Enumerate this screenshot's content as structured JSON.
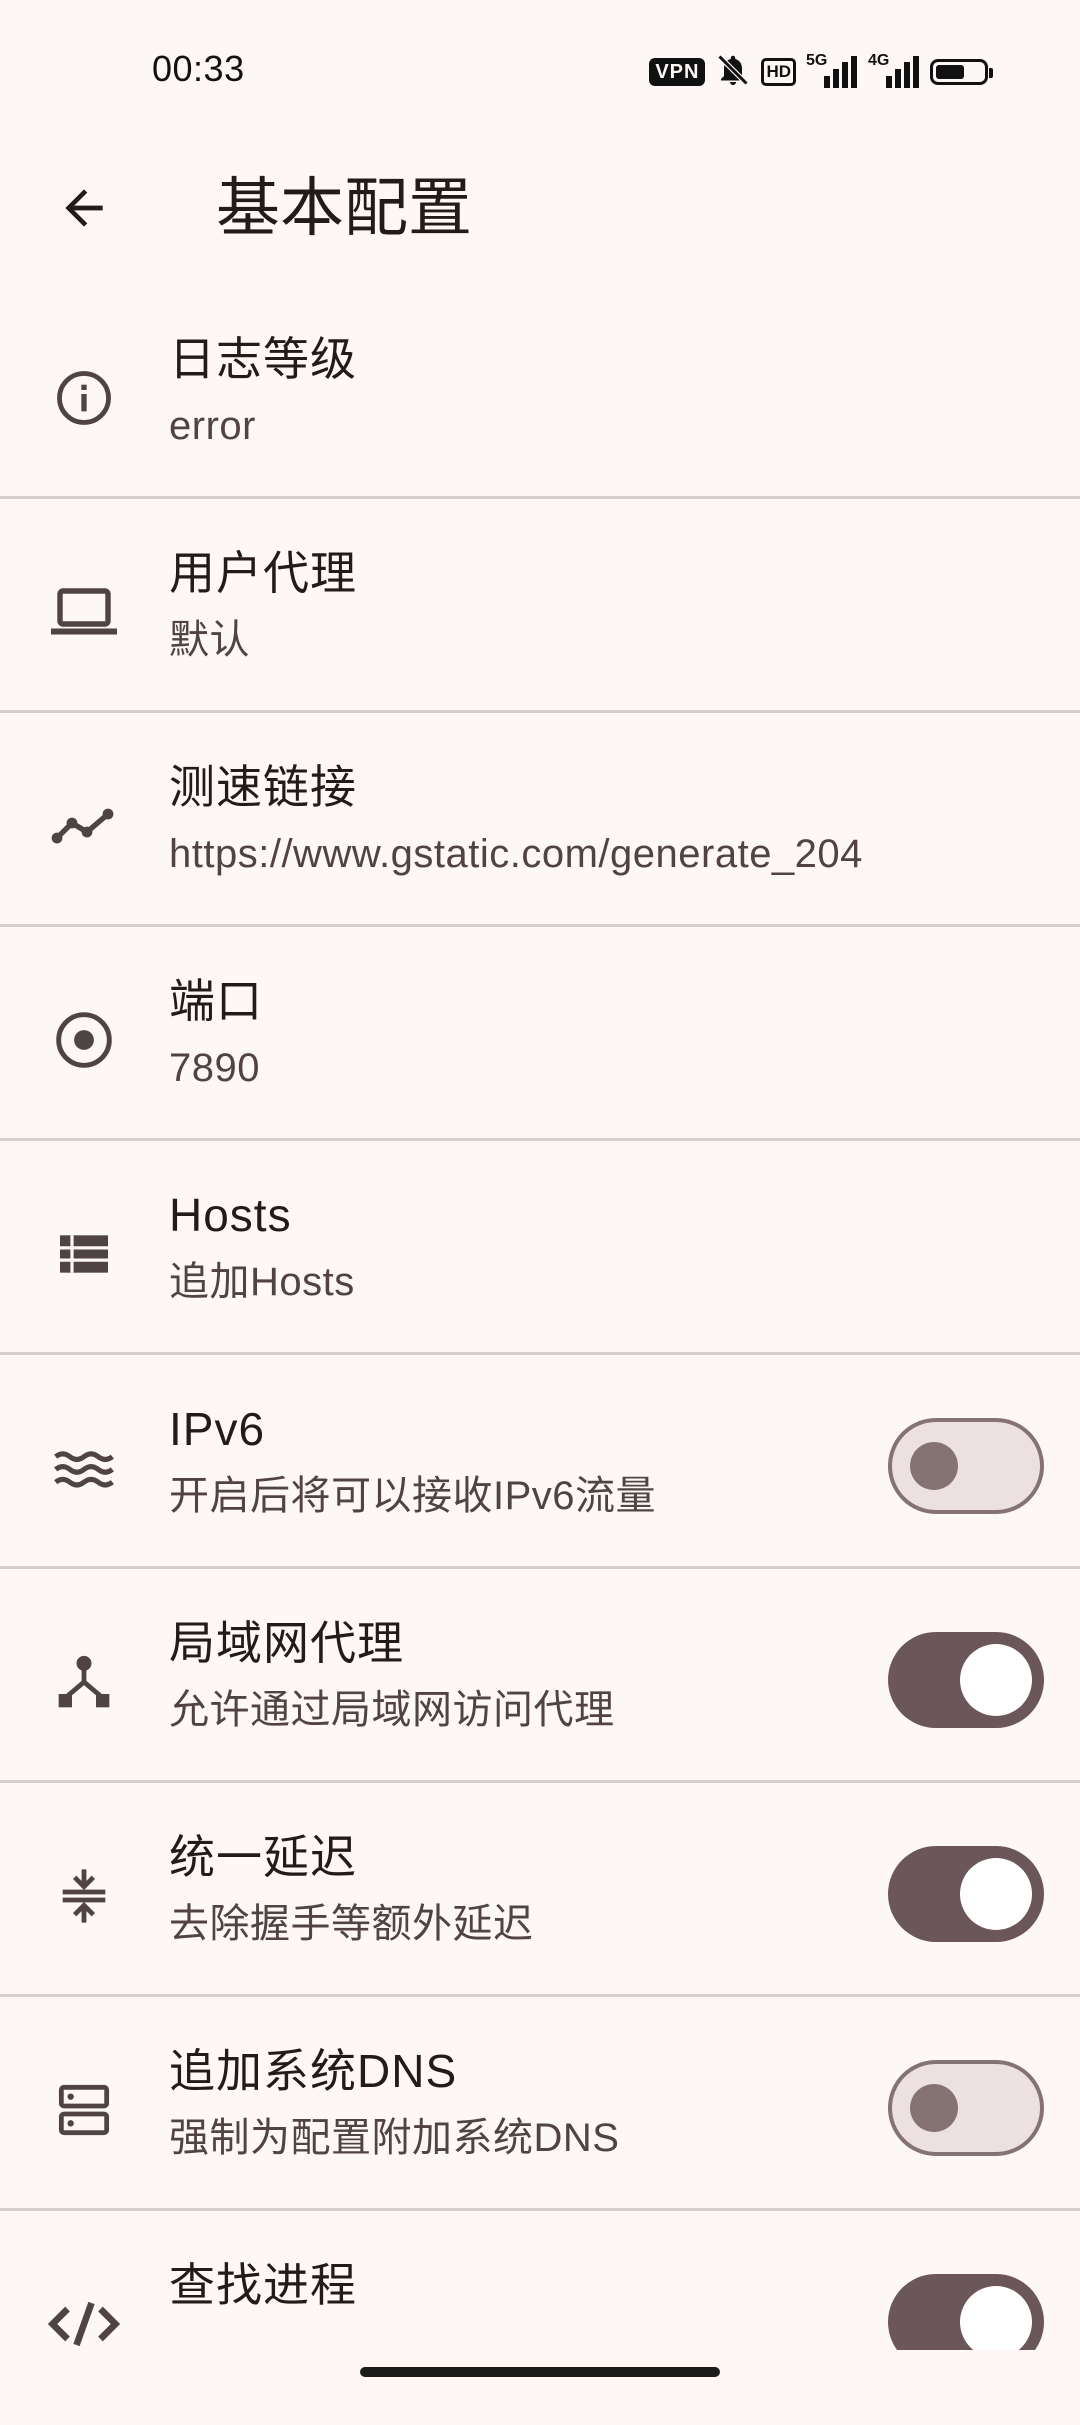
{
  "status_bar": {
    "time": "00:33",
    "vpn_label": "VPN",
    "hd_label": "HD",
    "signal1_label": "5G",
    "signal2_label": "4G",
    "battery_level": 0.6,
    "icons": [
      "bell-off-icon",
      "signal-icon",
      "battery-icon"
    ]
  },
  "app_bar": {
    "title": "基本配置",
    "back_icon": "arrow-back-icon"
  },
  "colors": {
    "background": "#fdf8f6",
    "divider": "#d7cfce",
    "switch_on": "#6b5759",
    "switch_off_track": "#ece1e0",
    "switch_off_border": "#857373"
  },
  "settings": [
    {
      "icon": "info-icon",
      "title": "日志等级",
      "subtitle": "error"
    },
    {
      "icon": "laptop-icon",
      "title": "用户代理",
      "subtitle": "默认"
    },
    {
      "icon": "timeline-icon",
      "title": "测速链接",
      "subtitle": "https://www.gstatic.com/generate_204"
    },
    {
      "icon": "radio-button-icon",
      "title": "端口",
      "subtitle": "7890"
    },
    {
      "icon": "list-icon",
      "title": "Hosts",
      "subtitle": "追加Hosts"
    },
    {
      "icon": "waves-icon",
      "title": "IPv6",
      "subtitle": "开启后将可以接收IPv6流量",
      "toggle": false
    },
    {
      "icon": "lan-icon",
      "title": "局域网代理",
      "subtitle": "允许通过局域网访问代理",
      "toggle": true
    },
    {
      "icon": "compress-icon",
      "title": "统一延迟",
      "subtitle": "去除握手等额外延迟",
      "toggle": true
    },
    {
      "icon": "dns-icon",
      "title": "追加系统DNS",
      "subtitle": "强制为配置附加系统DNS",
      "toggle": false
    },
    {
      "icon": "code-icon",
      "title": "查找进程",
      "subtitle": "",
      "toggle": true
    }
  ]
}
